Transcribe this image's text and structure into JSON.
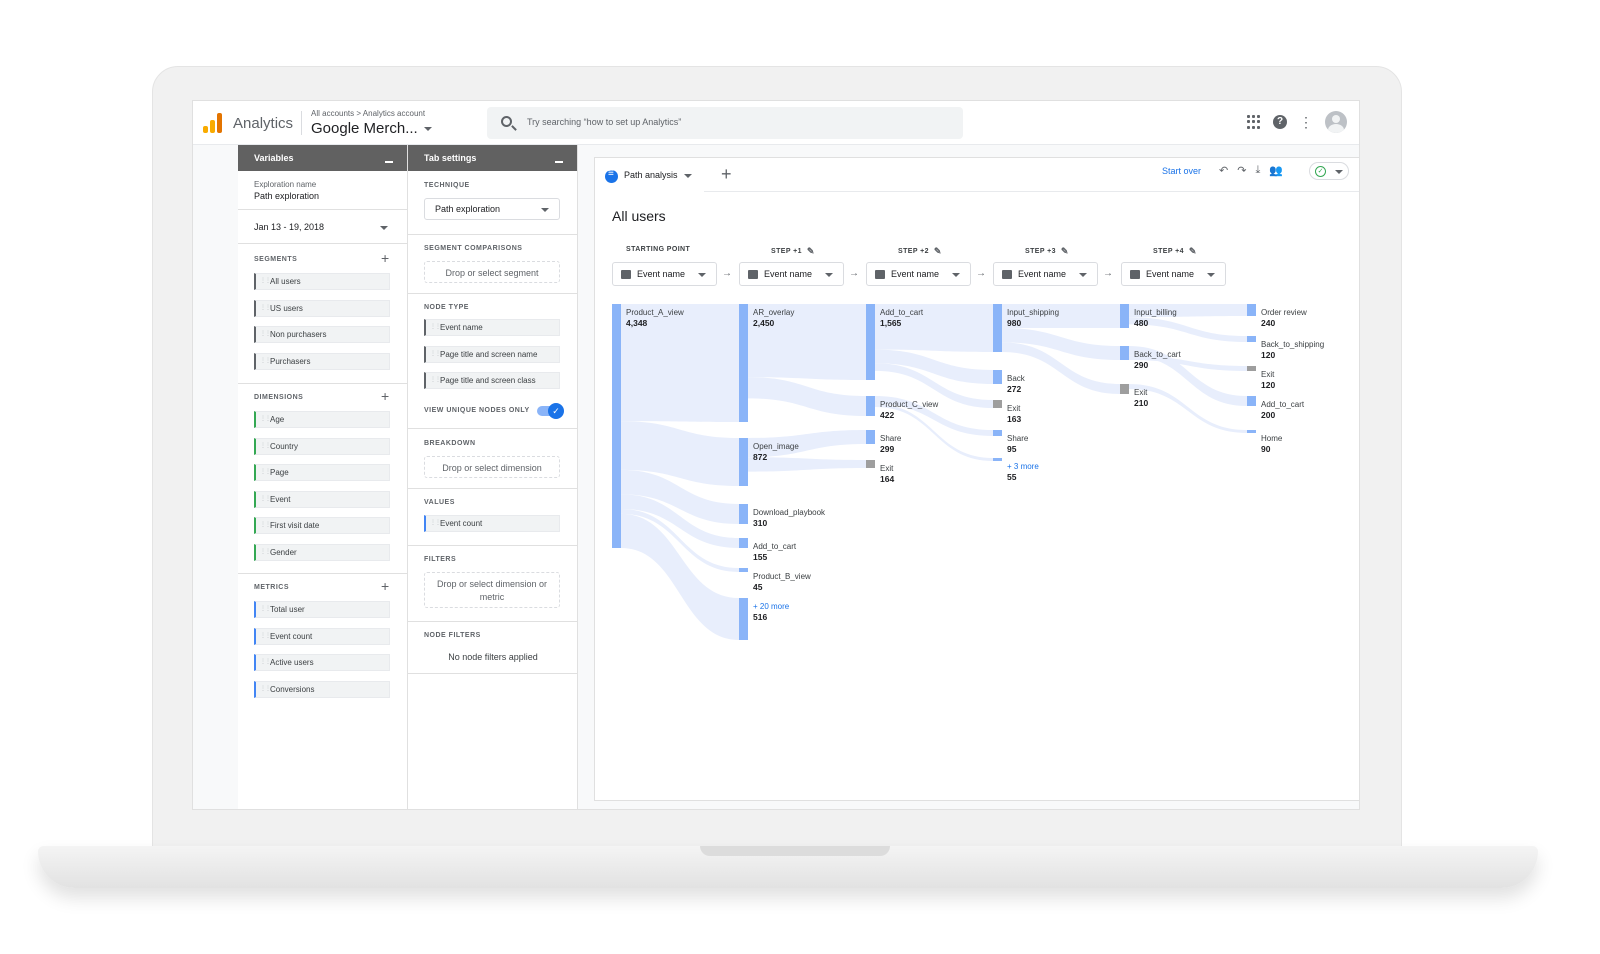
{
  "header": {
    "app_name": "Analytics",
    "breadcrumb": "All accounts > Analytics account",
    "property": "Google Merch...",
    "search_placeholder": "Try searching “how to set up Analytics”"
  },
  "variables_panel": {
    "title": "Variables",
    "exploration_label": "Exploration name",
    "exploration_name": "Path exploration",
    "date_range": "Jan 13 - 19, 2018",
    "segments_label": "SEGMENTS",
    "segments": [
      "All users",
      "US users",
      "Non purchasers",
      "Purchasers"
    ],
    "dimensions_label": "DIMENSIONS",
    "dimensions": [
      "Age",
      "Country",
      "Page",
      "Event",
      "First visit date",
      "Gender"
    ],
    "metrics_label": "METRICS",
    "metrics": [
      "Total user",
      "Event count",
      "Active users",
      "Conversions"
    ]
  },
  "tab_settings": {
    "title": "Tab settings",
    "technique_label": "TECHNIQUE",
    "technique_value": "Path exploration",
    "segment_comparisons_label": "SEGMENT COMPARISONS",
    "segment_drop": "Drop or select segment",
    "node_type_label": "NODE TYPE",
    "node_types": [
      "Event name",
      "Page title and screen name",
      "Page title and screen class"
    ],
    "unique_nodes_label": "VIEW UNIQUE NODES ONLY",
    "breakdown_label": "BREAKDOWN",
    "breakdown_drop": "Drop or select dimension",
    "values_label": "VALUES",
    "values_chip": "Event count",
    "filters_label": "FILTERS",
    "filters_drop": "Drop or select dimension or metric",
    "node_filters_label": "NODE FILTERS",
    "node_filters_text": "No node filters applied"
  },
  "canvas": {
    "tab_name": "Path analysis",
    "start_over": "Start over",
    "title": "All users",
    "steps": [
      "STARTING POINT",
      "STEP +1",
      "STEP +2",
      "STEP +3",
      "STEP +4"
    ],
    "step_select": "Event name"
  },
  "nodes": [
    {
      "col": 0,
      "name": "Product_A_view",
      "value": "4,348"
    },
    {
      "col": 1,
      "name": "AR_overlay",
      "value": "2,450"
    },
    {
      "col": 1,
      "name": "Open_image",
      "value": "872"
    },
    {
      "col": 1,
      "name": "Download_playbook",
      "value": "310"
    },
    {
      "col": 1,
      "name": "Add_to_cart",
      "value": "155"
    },
    {
      "col": 1,
      "name": "Product_B_view",
      "value": "45"
    },
    {
      "col": 1,
      "name": "+ 20 more",
      "value": "516"
    },
    {
      "col": 2,
      "name": "Add_to_cart",
      "value": "1,565"
    },
    {
      "col": 2,
      "name": "Product_C_view",
      "value": "422"
    },
    {
      "col": 2,
      "name": "Share",
      "value": "299"
    },
    {
      "col": 2,
      "name": "Exit",
      "value": "164"
    },
    {
      "col": 3,
      "name": "Input_shipping",
      "value": "980"
    },
    {
      "col": 3,
      "name": "Back",
      "value": "272"
    },
    {
      "col": 3,
      "name": "Exit",
      "value": "163"
    },
    {
      "col": 3,
      "name": "Share",
      "value": "95"
    },
    {
      "col": 3,
      "name": "+ 3 more",
      "value": "55"
    },
    {
      "col": 4,
      "name": "Input_billing",
      "value": "480"
    },
    {
      "col": 4,
      "name": "Back_to_cart",
      "value": "290"
    },
    {
      "col": 4,
      "name": "Exit",
      "value": "210"
    },
    {
      "col": 5,
      "name": "Order review",
      "value": "240"
    },
    {
      "col": 5,
      "name": "Back_to_shipping",
      "value": "120"
    },
    {
      "col": 5,
      "name": "Exit",
      "value": "120"
    },
    {
      "col": 5,
      "name": "Add_to_cart",
      "value": "200"
    },
    {
      "col": 5,
      "name": "Home",
      "value": "90"
    }
  ],
  "colors": {
    "node": "#8ab4f8",
    "link": "#e8eefc",
    "exit": "#9e9e9e",
    "accent": "#1a73e8"
  }
}
